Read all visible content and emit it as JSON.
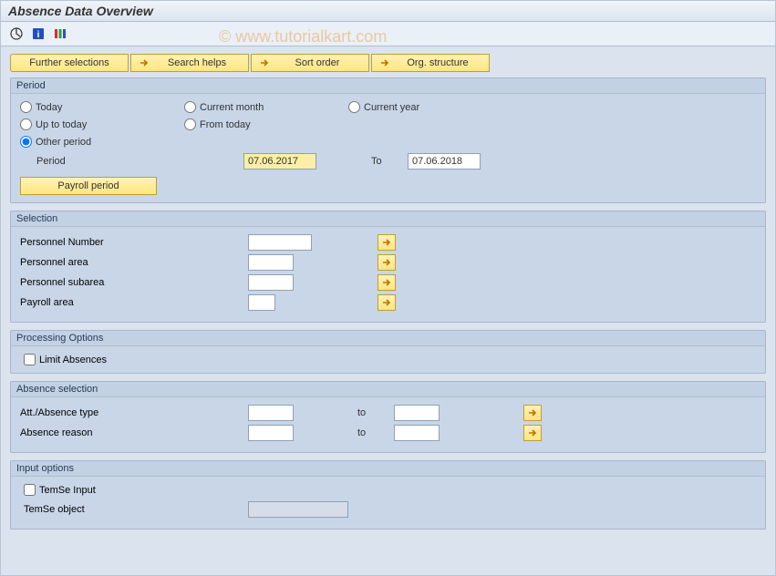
{
  "title": "Absence Data Overview",
  "watermark": "© www.tutorialkart.com",
  "topButtons": {
    "further": "Further selections",
    "searchHelps": "Search helps",
    "sortOrder": "Sort order",
    "orgStructure": "Org. structure"
  },
  "period": {
    "groupTitle": "Period",
    "radios": {
      "today": "Today",
      "currentMonth": "Current month",
      "currentYear": "Current year",
      "upToToday": "Up to today",
      "fromToday": "From today",
      "otherPeriod": "Other period"
    },
    "periodLabel": "Period",
    "fromValue": "07.06.2017",
    "toLabel": "To",
    "toValue": "07.06.2018",
    "payrollPeriodBtn": "Payroll period"
  },
  "selection": {
    "groupTitle": "Selection",
    "personnelNumber": "Personnel Number",
    "personnelArea": "Personnel area",
    "personnelSubarea": "Personnel subarea",
    "payrollArea": "Payroll area"
  },
  "processing": {
    "groupTitle": "Processing Options",
    "limitAbsences": "Limit Absences"
  },
  "absenceSelection": {
    "groupTitle": "Absence selection",
    "attAbsType": "Att./Absence type",
    "absReason": "Absence reason",
    "toLabel": "to"
  },
  "inputOptions": {
    "groupTitle": "Input options",
    "temseInput": "TemSe Input",
    "temseObject": "TemSe object"
  }
}
